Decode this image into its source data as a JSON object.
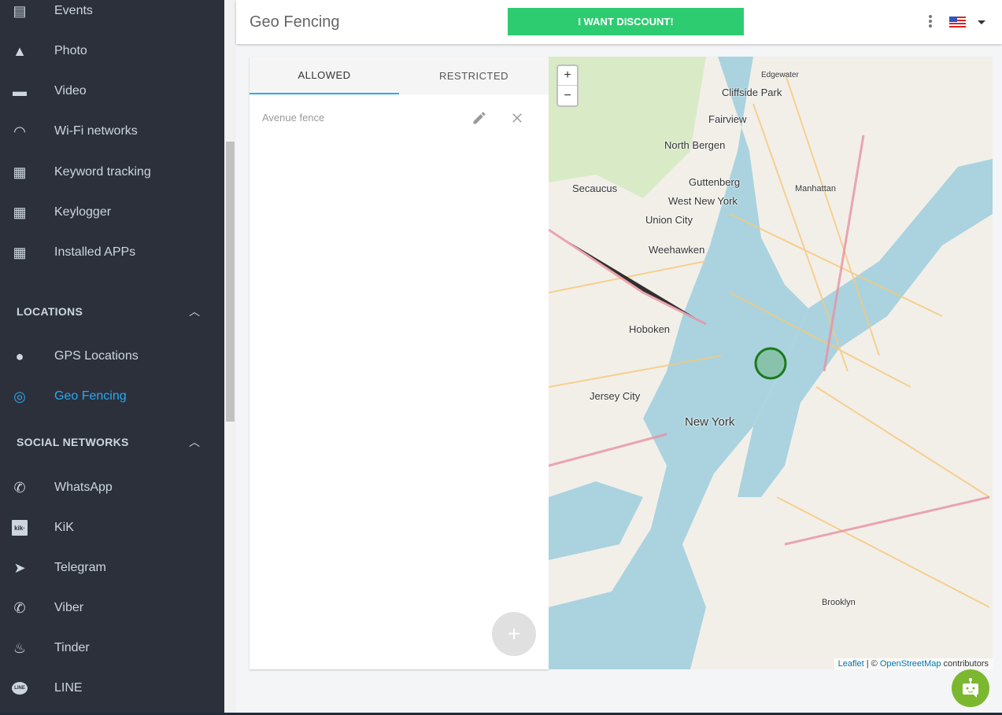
{
  "sidebar": {
    "items_top": [
      {
        "label": "Events",
        "icon": "calendar-icon"
      },
      {
        "label": "Photo",
        "icon": "image-icon"
      },
      {
        "label": "Video",
        "icon": "movie-icon"
      },
      {
        "label": "Wi-Fi networks",
        "icon": "wifi-icon"
      },
      {
        "label": "Keyword tracking",
        "icon": "keyboard-hide-icon"
      },
      {
        "label": "Keylogger",
        "icon": "keyboard-icon"
      },
      {
        "label": "Installed APPs",
        "icon": "apps-grid-icon"
      }
    ],
    "locations": {
      "title": "LOCATIONS",
      "items": [
        {
          "label": "GPS Locations",
          "icon": "map-pin-icon"
        },
        {
          "label": "Geo Fencing",
          "icon": "target-icon",
          "active": true
        }
      ]
    },
    "social": {
      "title": "SOCIAL NETWORKS",
      "items": [
        {
          "label": "WhatsApp",
          "icon": "whatsapp-icon"
        },
        {
          "label": "KiK",
          "icon": "kik-icon"
        },
        {
          "label": "Telegram",
          "icon": "telegram-icon"
        },
        {
          "label": "Viber",
          "icon": "viber-icon"
        },
        {
          "label": "Tinder",
          "icon": "tinder-icon"
        },
        {
          "label": "LINE",
          "icon": "line-icon"
        }
      ]
    },
    "kik_glyph": "kik·",
    "line_glyph": "LINE"
  },
  "header": {
    "title": "Geo Fencing",
    "discount_label": "I WANT DISCOUNT!",
    "language": "US"
  },
  "panel": {
    "tabs": [
      {
        "label": "ALLOWED",
        "active": true
      },
      {
        "label": "RESTRICTED"
      }
    ],
    "fences": [
      {
        "name": "Avenue fence"
      }
    ],
    "add_label": "+"
  },
  "map": {
    "zoom_in": "+",
    "zoom_out": "−",
    "attribution": {
      "leaflet": "Leaflet",
      "sep": " | © ",
      "osm": "OpenStreetMap",
      "suffix": " contributors"
    },
    "labels": [
      "Cliffside Park",
      "Edgewater",
      "Fairview",
      "North Bergen",
      "Secaucus",
      "Guttenberg",
      "West New York",
      "Union City",
      "Weehawken",
      "Manhattan",
      "Hoboken",
      "Jersey City",
      "New York",
      "Brooklyn"
    ],
    "colors": {
      "water": "#aad3df",
      "land": "#f2efe9",
      "fence": "#1a7a1a"
    }
  },
  "colors": {
    "sidebar": "#2b303b",
    "accent": "#29a9f0",
    "discount": "#2ecc71",
    "bot": "#7cb82f"
  }
}
